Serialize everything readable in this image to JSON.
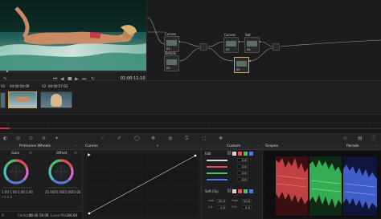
{
  "viewer": {
    "timecode": "01:00:11:10"
  },
  "timecodes": {
    "clip1": "04:00:56:09",
    "clip2": "04:00:57:03"
  },
  "clips": [
    {
      "track": "V1"
    },
    {
      "track": "V2"
    }
  ],
  "nodes": [
    {
      "label": "Curves",
      "num": "01"
    },
    {
      "label": "Details",
      "num": "02"
    },
    {
      "label": "Curves",
      "num": "03"
    },
    {
      "label": "Sat",
      "num": "04"
    },
    {
      "label": "",
      "num": "05"
    }
  ],
  "panels": {
    "primaries": "Primaries Wheels",
    "curves": "Curves",
    "custom": "Custom",
    "scopes": "Scopes",
    "parade": "Parade"
  },
  "wheels": [
    {
      "name": "Gain",
      "values": [
        "1.00",
        "1.00",
        "1.00",
        "1.00"
      ]
    },
    {
      "name": "Offset",
      "values": [
        "25.00",
        "25.00",
        "25.00",
        "25.00"
      ]
    }
  ],
  "primaries_footer": {
    "contrast_label": "Contrast",
    "contrast_value": "50.00",
    "pivot_value": "50.00",
    "lumamix_label": "Luma Mix",
    "lumamix_value": "100.00",
    "first_label": "A"
  },
  "custom": {
    "edit_label": "Edit",
    "intensity_values": [
      "100",
      "100",
      "100",
      "100"
    ],
    "softclip_label": "Soft Clip",
    "low_label": "Low",
    "low_value": "50.0",
    "high_label": "High",
    "high_value": "50.0",
    "ls_label": "L.S.",
    "ls_value": "0.0",
    "hs_label": "H.S.",
    "hs_value": "0.0"
  },
  "colors": {
    "accent": "#d9a23a",
    "red": "#e05050",
    "green": "#46c46a",
    "blue": "#4a78e0"
  }
}
